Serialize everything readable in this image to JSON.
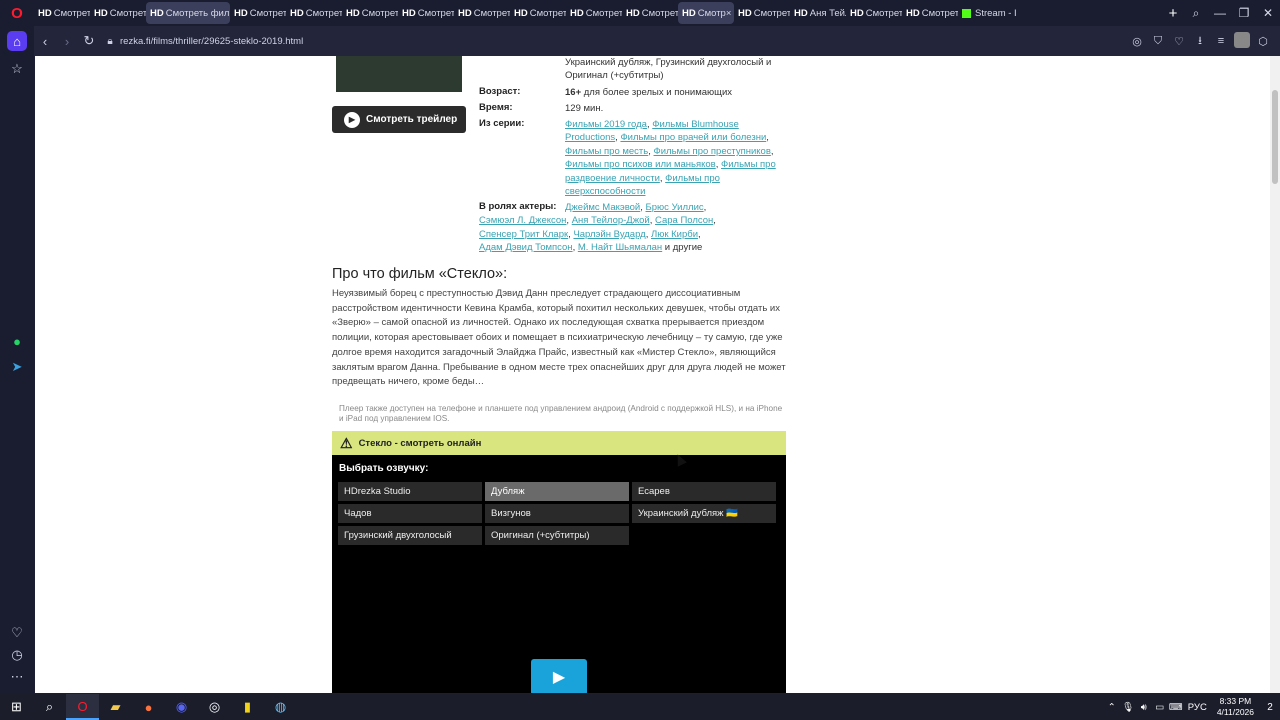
{
  "browser": {
    "logo": "O",
    "tabs": [
      {
        "hd": "HD",
        "title": "Смотреть",
        "active": false
      },
      {
        "hd": "HD",
        "title": "Смотреть",
        "active": false
      },
      {
        "hd": "HD",
        "title": "Смотреть фильм",
        "active": true
      },
      {
        "hd": "HD",
        "title": "Смотреть",
        "active": false
      },
      {
        "hd": "HD",
        "title": "Смотреть",
        "active": false
      },
      {
        "hd": "HD",
        "title": "Смотреть",
        "active": false
      },
      {
        "hd": "HD",
        "title": "Смотреть",
        "active": false
      },
      {
        "hd": "HD",
        "title": "Смотреть",
        "active": false
      },
      {
        "hd": "HD",
        "title": "Смотреть",
        "active": false
      },
      {
        "hd": "HD",
        "title": "Смотреть",
        "active": false
      },
      {
        "hd": "HD",
        "title": "Смотреть",
        "active": false
      },
      {
        "hd": "HD",
        "title": "Смотр",
        "active": true,
        "close": "×"
      },
      {
        "hd": "HD",
        "title": "Смотреть",
        "active": false
      },
      {
        "hd": "HD",
        "title": "Аня Тейлор",
        "active": false
      },
      {
        "hd": "HD",
        "title": "Смотреть",
        "active": false
      },
      {
        "hd": "HD",
        "title": "Смотреть",
        "active": false
      },
      {
        "hd": "",
        "title": "Stream - I",
        "active": false,
        "kick": true
      }
    ],
    "new_tab": "+",
    "url": "rezka.fi/films/thriller/29625-steklo-2019.html"
  },
  "movie": {
    "dubbing_list": "Украинский дубляж, Грузинский двухголосый и Оригинал (+субтитры)",
    "age_label": "Возраст:",
    "age_value": "16+",
    "age_note": " для более зрелых и понимающих",
    "time_label": "Время:",
    "time_value": "129 мин.",
    "series_label": "Из серии:",
    "series": [
      "Фильмы 2019 года",
      "Фильмы Blumhouse Productions",
      "Фильмы про врачей или болезни",
      "Фильмы про месть",
      "Фильмы про преступников",
      "Фильмы про психов или маньяков",
      "Фильмы про раздвоение личности",
      "Фильмы про сверхспособности"
    ],
    "actors_label": "В ролях актеры:",
    "actors": [
      "Джеймс Макэвой",
      "Брюс Уиллис",
      "Сэмюэл Л. Джексон",
      "Аня Тейлор-Джой",
      "Сара Полсон",
      "Спенсер Трит Кларк",
      "Чарлэйн Вудард",
      "Люк Кирби",
      "Адам Дэвид Томпсон",
      "М. Найт Шьямалан"
    ],
    "actors_tail": " и другие",
    "trailer_label": "Смотреть трейлер",
    "about_title": "Про что фильм «Стекло»:",
    "about_text": "Неуязвимый борец с преступностью Дэвид Данн преследует страдающего диссоциативным расстройством идентичности Кевина Крамба, который похитил нескольких девушек, чтобы отдать их «Зверю» – самой опасной из личностей. Однако их последующая схватка прерывается приездом полиции, которая арестовывает обоих и помещает в психиатрическую лечебницу – ту самую, где уже долгое время находится загадочный Элайджа Прайс, известный как «Мистер Стекло», являющийся заклятым врагом Данна. Пребывание в одном месте трех опаснейших друг для друга людей не может предвещать ничего, кроме беды…",
    "player_note": "Плеер также доступен на телефоне и планшете под управлением андроид (Android с поддержкой HLS), и на iPhone и iPad под управлением IOS.",
    "watch_title": "Стекло - смотреть онлайн",
    "voice_heading": "Выбрать озвучку:",
    "voices": [
      "HDrezka Studio",
      "Дубляж",
      "Есарев",
      "Чадов",
      "Визгунов",
      "Украинский дубляж 🇺🇦",
      "Грузинский двухголосый",
      "Оригинал (+субтитры)"
    ],
    "selected_voice": "Дубляж"
  },
  "taskbar": {
    "language": "РУС",
    "time": "8:33 PM",
    "date": "4/11/2026",
    "notifications": "2"
  },
  "colors": {
    "accent": "#5a3df0",
    "link": "#3aa3b3",
    "alert": "#d9e57f",
    "play": "#1aa3db"
  }
}
